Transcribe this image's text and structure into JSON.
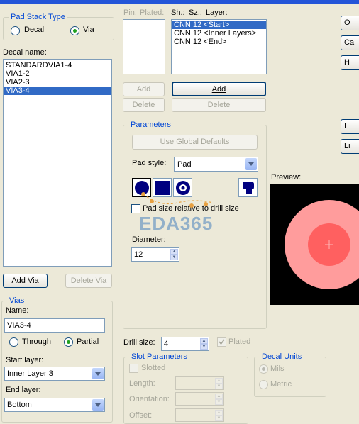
{
  "padstack_type": {
    "title": "Pad Stack Type",
    "decal": "Decal",
    "via": "Via",
    "selected": "Via"
  },
  "decal_name": {
    "label": "Decal name:",
    "items": [
      "STANDARDVIA1-4",
      "VIA1-2",
      "VIA2-3",
      "VIA3-4"
    ],
    "selected": "VIA3-4"
  },
  "decal_buttons": {
    "add_via": "Add Via",
    "delete_via": "Delete Via"
  },
  "vias": {
    "title": "Vias",
    "name_label": "Name:",
    "name_value": "VIA3-4",
    "through": "Through",
    "partial": "Partial",
    "selected": "Partial",
    "start_label": "Start layer:",
    "start_value": "Inner Layer 3",
    "end_label": "End layer:",
    "end_value": "Bottom"
  },
  "pin_list": {
    "pin_header": "Pin:",
    "plated_header": "Plated:",
    "add": "Add",
    "delete": "Delete"
  },
  "layer_list": {
    "sh_header": "Sh.:",
    "sz_header": "Sz.:",
    "layer_header": "Layer:",
    "items": [
      "CNN 12 <Start>",
      "CNN 12 <Inner Layers>",
      "CNN 12 <End>"
    ],
    "selected": "CNN 12 <Start>",
    "add": "Add",
    "delete": "Delete"
  },
  "parameters": {
    "title": "Parameters",
    "use_global": "Use Global Defaults",
    "pad_style_label": "Pad style:",
    "pad_style_value": "Pad",
    "pad_size_relative": "Pad size relative to drill size",
    "diameter_label": "Diameter:",
    "diameter_value": "12",
    "pad_shapes": [
      "round-pad-icon",
      "square-pad-icon",
      "annular-pad-icon"
    ],
    "custom_shape": "custom-pad-icon"
  },
  "preview": {
    "label": "Preview:"
  },
  "drill": {
    "label": "Drill size:",
    "value": "4",
    "plated": "Plated"
  },
  "slot": {
    "title": "Slot Parameters",
    "slotted": "Slotted",
    "length": "Length:",
    "orientation": "Orientation:",
    "offset": "Offset:"
  },
  "decal_units": {
    "title": "Decal Units",
    "mils": "Mils",
    "metric": "Metric",
    "selected": "Mils"
  },
  "watermark": "EDA365",
  "right_buttons": [
    "O",
    "Ca",
    "H",
    "I",
    "Li"
  ]
}
